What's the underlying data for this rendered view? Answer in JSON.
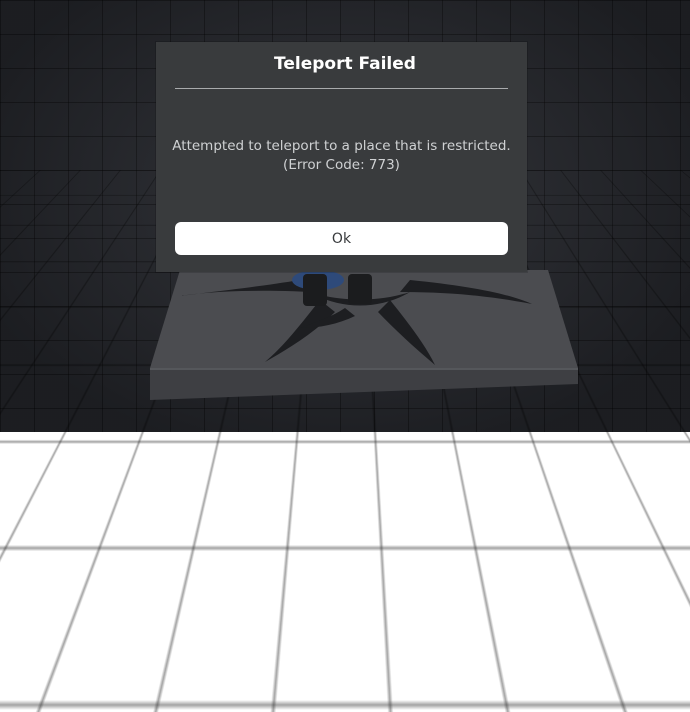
{
  "dialog": {
    "title": "Teleport Failed",
    "message_line1": "Attempted to teleport to a place that is restricted.",
    "message_line2": "(Error Code: 773)",
    "ok_label": "Ok"
  },
  "colors": {
    "dialog_bg": "#393b3d",
    "button_bg": "#ffffff",
    "title_text": "#ffffff",
    "message_text": "#cfd1d3"
  }
}
